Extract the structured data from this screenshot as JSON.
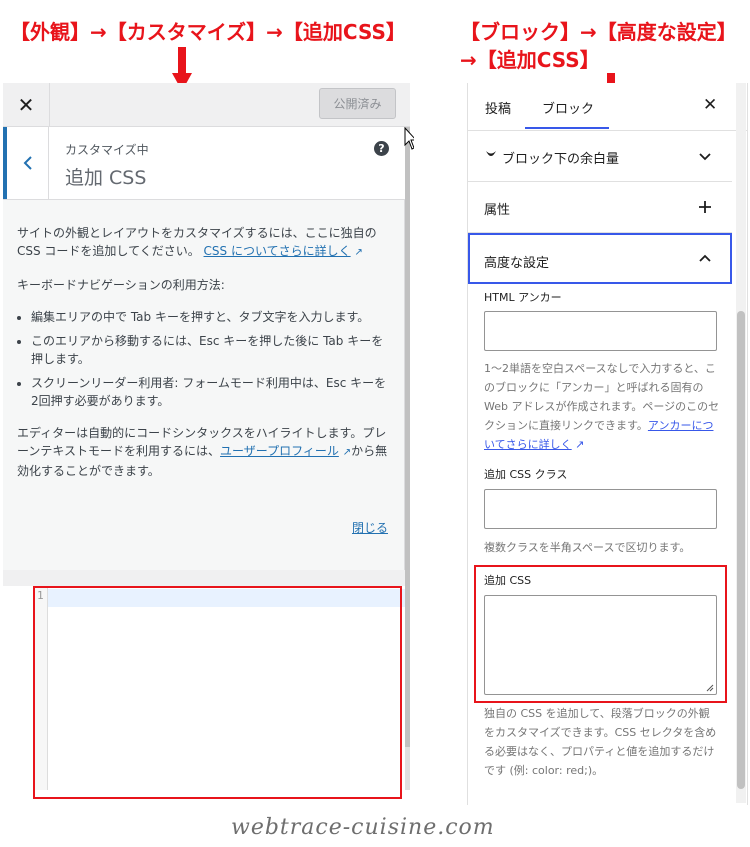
{
  "annotations": {
    "left_heading": "【外観】→【カスタマイズ】→【追加CSS】",
    "right_heading_line1": "【ブロック】→【高度な設定】",
    "right_heading_line2": "→【追加CSS】",
    "highlight_color": "#e8141b"
  },
  "customizer": {
    "close_icon": "close-icon",
    "publish_label": "公開済み",
    "subtitle": "カスタマイズ中",
    "title": "追加 CSS",
    "help_icon": "?",
    "desc_prefix": "サイトの外観とレイアウトをカスタマイズするには、ここに独自の CSS コードを追加してください。 ",
    "desc_link": "CSS についてさらに詳しく",
    "keyboard_heading": "キーボードナビゲーションの利用方法:",
    "bullets": [
      "編集エリアの中で Tab キーを押すと、タブ文字を入力します。",
      "このエリアから移動するには、Esc キーを押した後に Tab キーを押します。",
      "スクリーンリーダー利用者: フォームモード利用中は、Esc キーを2回押す必要があります。"
    ],
    "editor_prefix": "エディターは自動的にコードシンタックスをハイライトします。プレーンテキストモードを利用するには、",
    "editor_link": "ユーザープロフィール",
    "editor_suffix": "から無効化することができます。",
    "close_link": "閉じる",
    "line_number": "1"
  },
  "block_sidebar": {
    "tabs": [
      "投稿",
      "ブロック"
    ],
    "active_tab": "ブロック",
    "close_icon": "close-icon",
    "sections": [
      {
        "label": "ブロック下の余白量",
        "icon": "chevron-down-icon"
      },
      {
        "label": "属性",
        "icon": "plus-icon"
      },
      {
        "label": "高度な設定",
        "icon": "chevron-up-icon"
      }
    ],
    "html_anchor_label": "HTML アンカー",
    "html_anchor_help": "1〜2単語を空白スペースなしで入力すると、このブロックに「アンカー」と呼ばれる固有の Web アドレスが作成されます。ページのこのセクションに直接リンクできます。",
    "html_anchor_help_link": "アンカーについてさらに詳しく",
    "css_class_label": "追加 CSS クラス",
    "css_class_help": "複数クラスを半角スペースで区切ります。",
    "additional_css_label": "追加 CSS",
    "additional_css_help": "独自の CSS を追加して、段落ブロックの外観をカスタマイズできます。CSS セレクタを含める必要はなく、プロパティと値を追加するだけです (例: color: red;)。",
    "accent_color": "#3858e9"
  },
  "watermark": "webtrace-cuisine.com"
}
